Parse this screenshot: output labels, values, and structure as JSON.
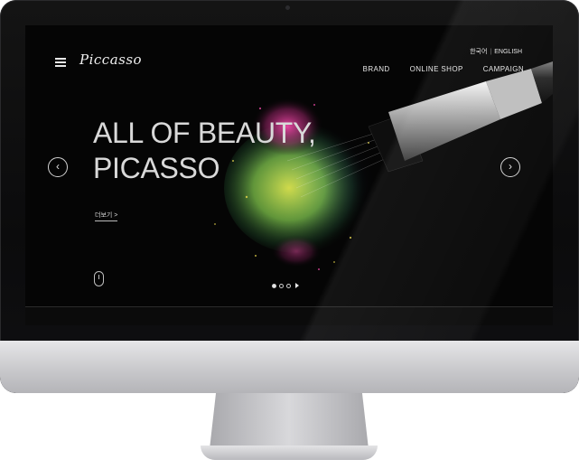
{
  "brand": {
    "logo_text": "Piccasso"
  },
  "header": {
    "lang_korean": "한국어",
    "lang_separator": "|",
    "lang_english": "ENGLISH",
    "nav": [
      "BRAND",
      "ONLINE SHOP",
      "CAMPAIGN"
    ]
  },
  "hero": {
    "line1": "ALL OF BEAUTY,",
    "line2": "PICASSO",
    "more_label": "더보기 >",
    "prev_arrow": "‹",
    "next_arrow": "›",
    "slides": {
      "total": 3,
      "active_index": 0
    }
  },
  "icons": [
    "menu-icon",
    "mouse-scroll-icon",
    "arrow-left-icon",
    "arrow-right-icon",
    "play-icon"
  ],
  "colors": {
    "screen_bg": "#050505",
    "text": "#e6e6e6",
    "powder_pink": "#e0479a",
    "powder_yellow": "#e8d63a",
    "powder_green": "#8fd24a"
  }
}
